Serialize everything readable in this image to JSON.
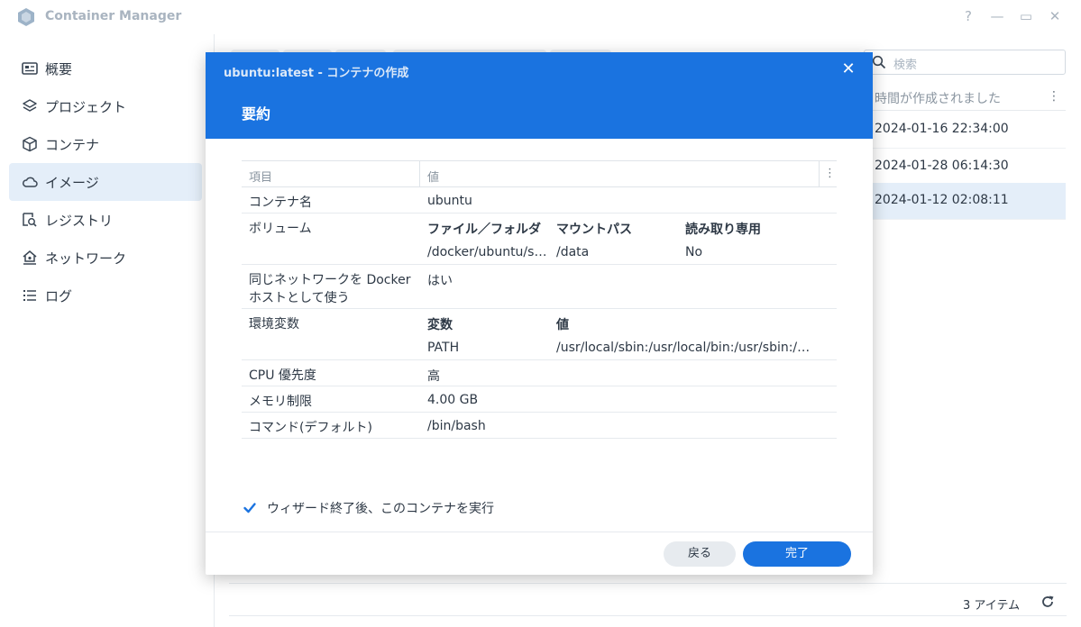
{
  "app": {
    "title": "Container Manager"
  },
  "window_controls": {
    "help": "?",
    "minimize": "—",
    "maximize": "▭",
    "close": "✕"
  },
  "sidebar": {
    "items": [
      {
        "label": "概要",
        "icon": "overview-icon"
      },
      {
        "label": "プロジェクト",
        "icon": "layers-icon"
      },
      {
        "label": "コンテナ",
        "icon": "cube-icon"
      },
      {
        "label": "イメージ",
        "icon": "cloud-icon",
        "active": true
      },
      {
        "label": "レジストリ",
        "icon": "registry-search-icon"
      },
      {
        "label": "ネットワーク",
        "icon": "network-home-icon"
      },
      {
        "label": "ログ",
        "icon": "list-icon"
      }
    ]
  },
  "background": {
    "search_placeholder": "検索",
    "column_header": "時間が作成されました",
    "column_menu": "⋮",
    "rows": [
      {
        "created": "2024-01-16 22:34:00",
        "selected": false
      },
      {
        "created": "2024-01-28 06:14:30",
        "selected": false
      },
      {
        "created": "2024-01-12 02:08:11",
        "selected": true
      }
    ],
    "item_count": "3 アイテム"
  },
  "modal": {
    "title": "ubuntu:latest - コンテナの作成",
    "step": "要約",
    "close": "✕",
    "table": {
      "header_item": "項目",
      "header_value": "値",
      "header_menu": "⋮",
      "container_name_key": "コンテナ名",
      "container_name_value": "ubuntu",
      "volume_key": "ボリューム",
      "volume_headers": [
        "ファイル／フォルダ",
        "マウントパス",
        "読み取り専用"
      ],
      "volume_row": [
        "/docker/ubuntu/ser...",
        "/data",
        "No"
      ],
      "host_network_key": "同じネットワークを Docker ホストとして使う",
      "host_network_value": "はい",
      "env_key": "環境変数",
      "env_headers": [
        "変数",
        "値"
      ],
      "env_row": [
        "PATH",
        "/usr/local/sbin:/usr/local/bin:/usr/sbin:/u..."
      ],
      "cpu_key": "CPU 優先度",
      "cpu_value": "高",
      "memory_key": "メモリ制限",
      "memory_value": "4.00 GB",
      "command_key": "コマンド(デフォルト)",
      "command_value": "/bin/bash"
    },
    "run_after_wizard": {
      "label": "ウィザード終了後、このコンテナを実行",
      "checked": true
    },
    "buttons": {
      "back": "戻る",
      "done": "完了"
    }
  },
  "colors": {
    "accent": "#1a73e0",
    "selected_bg": "#e4eef9"
  }
}
